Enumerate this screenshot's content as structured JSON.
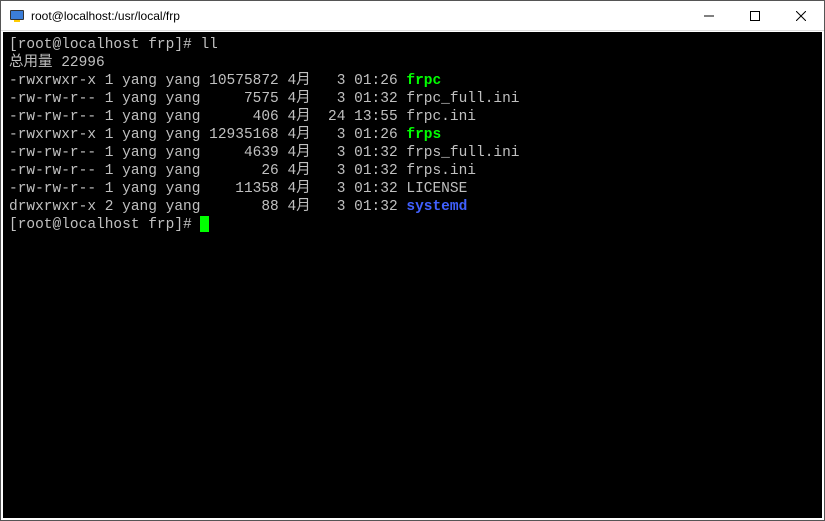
{
  "window": {
    "title": "root@localhost:/usr/local/frp"
  },
  "terminal": {
    "prompt1": "[root@localhost frp]# ",
    "command1": "ll",
    "total_line": "总用量 22996",
    "rows": [
      {
        "perm": "-rwxrwxr-x",
        "links": "1",
        "owner": "yang",
        "group": "yang",
        "size": "10575872",
        "month": "4月",
        "day": "  3",
        "time": "01:26",
        "name": "frpc",
        "color": "green"
      },
      {
        "perm": "-rw-rw-r--",
        "links": "1",
        "owner": "yang",
        "group": "yang",
        "size": "    7575",
        "month": "4月",
        "day": "  3",
        "time": "01:32",
        "name": "frpc_full.ini",
        "color": ""
      },
      {
        "perm": "-rw-rw-r--",
        "links": "1",
        "owner": "yang",
        "group": "yang",
        "size": "     406",
        "month": "4月",
        "day": " 24",
        "time": "13:55",
        "name": "frpc.ini",
        "color": ""
      },
      {
        "perm": "-rwxrwxr-x",
        "links": "1",
        "owner": "yang",
        "group": "yang",
        "size": "12935168",
        "month": "4月",
        "day": "  3",
        "time": "01:26",
        "name": "frps",
        "color": "green"
      },
      {
        "perm": "-rw-rw-r--",
        "links": "1",
        "owner": "yang",
        "group": "yang",
        "size": "    4639",
        "month": "4月",
        "day": "  3",
        "time": "01:32",
        "name": "frps_full.ini",
        "color": ""
      },
      {
        "perm": "-rw-rw-r--",
        "links": "1",
        "owner": "yang",
        "group": "yang",
        "size": "      26",
        "month": "4月",
        "day": "  3",
        "time": "01:32",
        "name": "frps.ini",
        "color": ""
      },
      {
        "perm": "-rw-rw-r--",
        "links": "1",
        "owner": "yang",
        "group": "yang",
        "size": "   11358",
        "month": "4月",
        "day": "  3",
        "time": "01:32",
        "name": "LICENSE",
        "color": ""
      },
      {
        "perm": "drwxrwxr-x",
        "links": "2",
        "owner": "yang",
        "group": "yang",
        "size": "      88",
        "month": "4月",
        "day": "  3",
        "time": "01:32",
        "name": "systemd",
        "color": "blue"
      }
    ],
    "prompt2": "[root@localhost frp]# "
  }
}
